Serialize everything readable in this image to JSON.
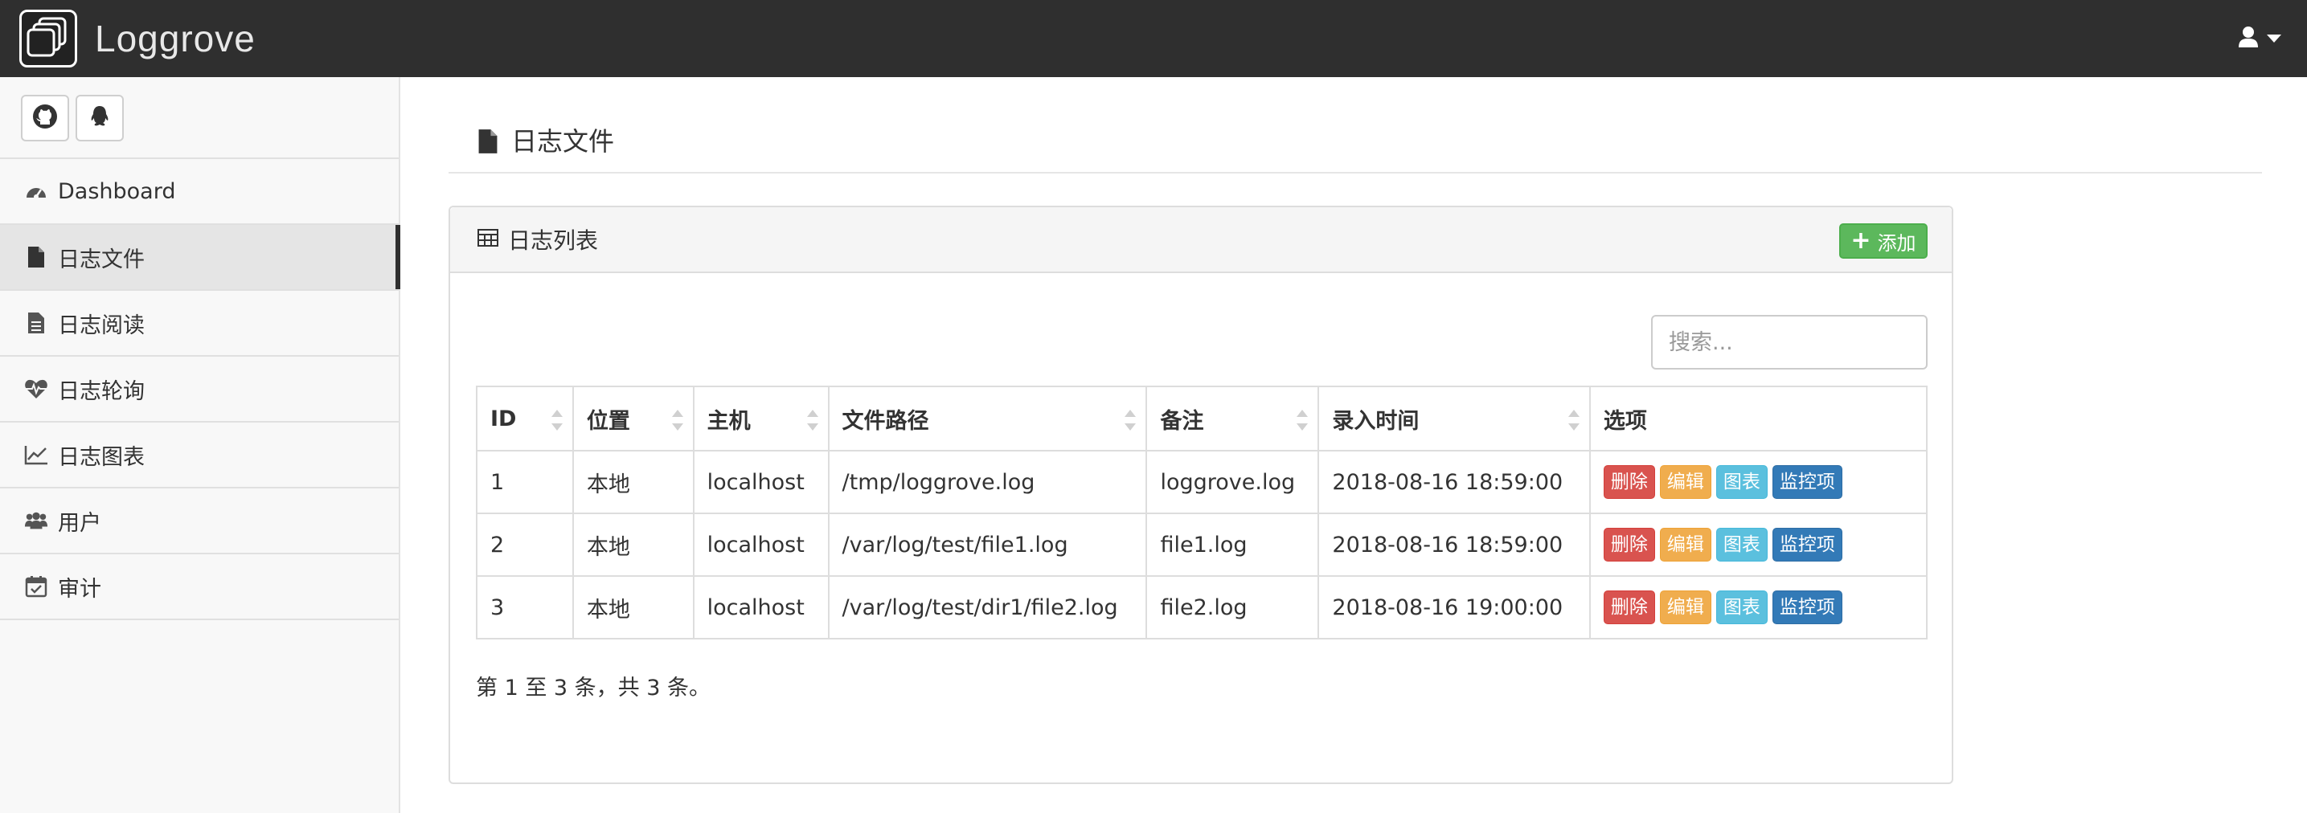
{
  "app": {
    "brand": "Loggrove"
  },
  "sidebar": {
    "social": [
      "github-icon",
      "qq-icon"
    ],
    "items": [
      {
        "label": "Dashboard",
        "icon": "dashboard-icon"
      },
      {
        "label": "日志文件",
        "icon": "file-icon",
        "active": true
      },
      {
        "label": "日志阅读",
        "icon": "file-text-icon"
      },
      {
        "label": "日志轮询",
        "icon": "heartbeat-icon"
      },
      {
        "label": "日志图表",
        "icon": "line-chart-icon"
      },
      {
        "label": "用户",
        "icon": "users-icon"
      },
      {
        "label": "审计",
        "icon": "calendar-check-icon"
      }
    ]
  },
  "page": {
    "title": "日志文件"
  },
  "panel": {
    "title": "日志列表",
    "add_label": "添加",
    "search_placeholder": "搜索...",
    "columns": [
      "ID",
      "位置",
      "主机",
      "文件路径",
      "备注",
      "录入时间",
      "选项"
    ],
    "rows": [
      {
        "id": "1",
        "location": "本地",
        "host": "localhost",
        "path": "/tmp/loggrove.log",
        "remark": "loggrove.log",
        "time": "2018-08-16 18:59:00"
      },
      {
        "id": "2",
        "location": "本地",
        "host": "localhost",
        "path": "/var/log/test/file1.log",
        "remark": "file1.log",
        "time": "2018-08-16 18:59:00"
      },
      {
        "id": "3",
        "location": "本地",
        "host": "localhost",
        "path": "/var/log/test/dir1/file2.log",
        "remark": "file2.log",
        "time": "2018-08-16 19:00:00"
      }
    ],
    "actions": {
      "delete": "删除",
      "edit": "编辑",
      "chart": "图表",
      "monitor": "监控项"
    },
    "info": "第 1 至 3 条，共 3 条。"
  },
  "colors": {
    "navbar": "#2f2f2f",
    "success": "#5cb85c",
    "danger": "#d9534f",
    "warning": "#f0ad4e",
    "info": "#5bc0de",
    "primary": "#337ab7"
  }
}
